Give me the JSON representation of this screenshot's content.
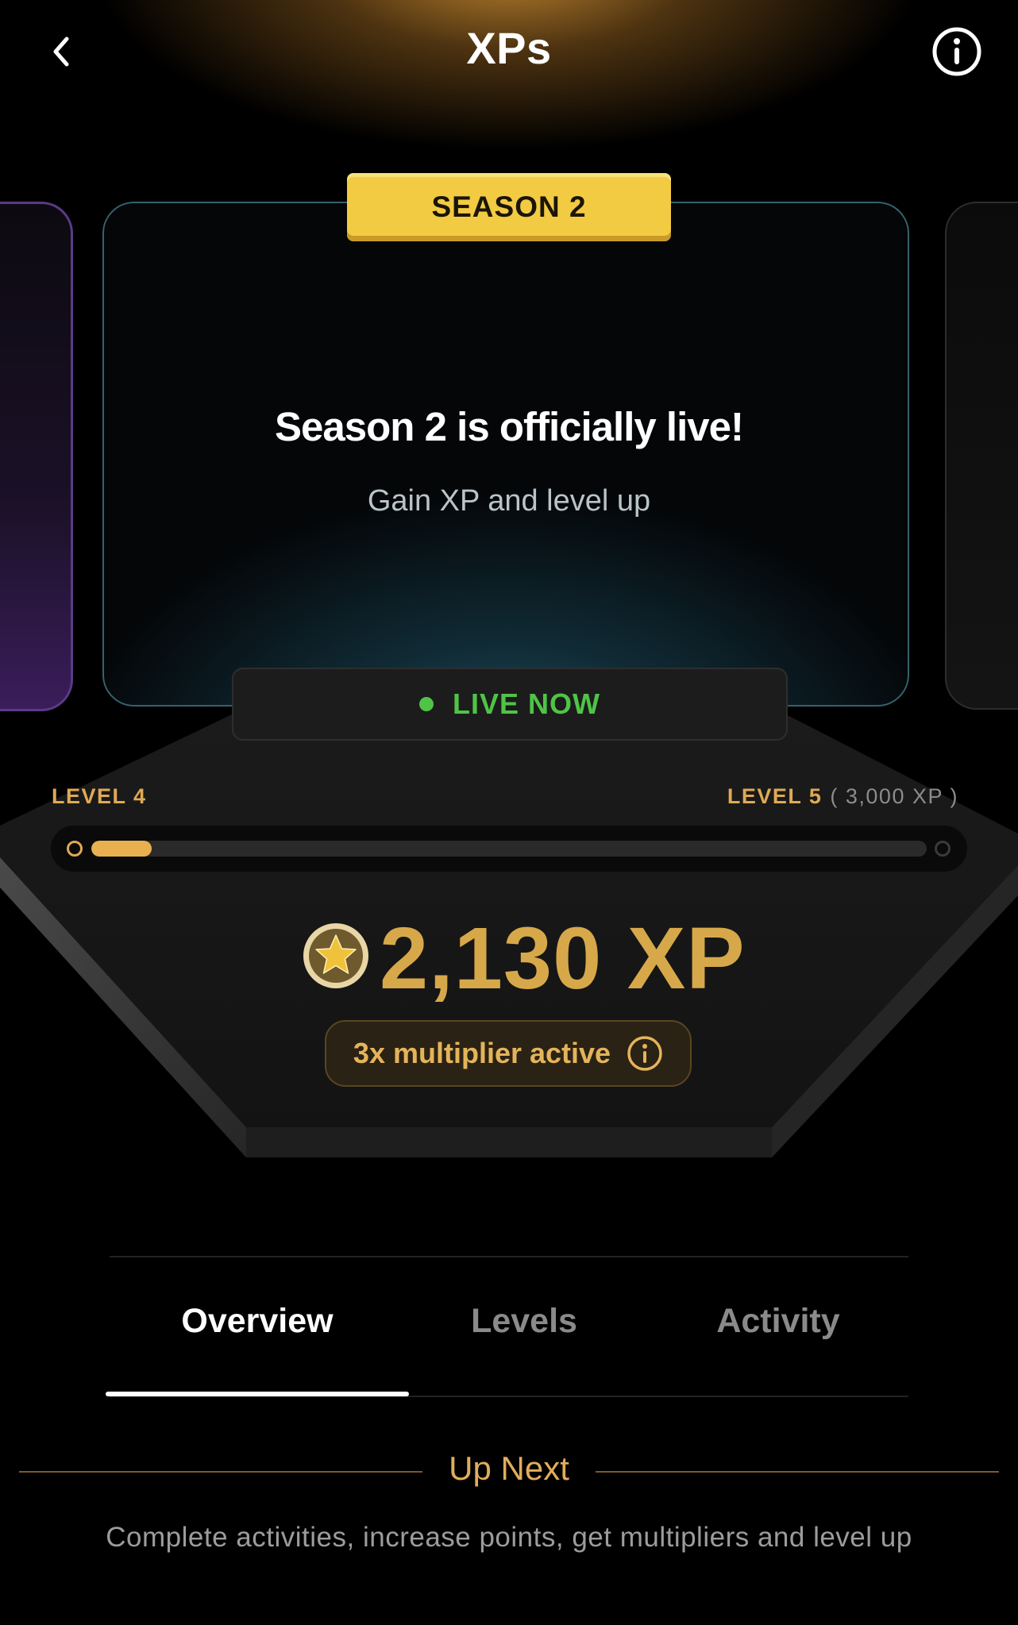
{
  "header": {
    "title": "XPs",
    "back_icon": "chevron-left-icon",
    "info_icon": "info-icon"
  },
  "carousel": {
    "badge": "SEASON 2",
    "headline": "Season 2 is officially live!",
    "subtitle": "Gain XP and level up",
    "status": "LIVE NOW"
  },
  "progress": {
    "current_level": "LEVEL 4",
    "next_level": "LEVEL 5",
    "next_level_xp": "( 3,000 XP )",
    "fill_fraction": 0.072
  },
  "xp": {
    "amount": "2,130 XP",
    "coin_icon": "star-coin-icon",
    "multiplier": "3x multiplier active"
  },
  "tabs": [
    {
      "label": "Overview",
      "active": true
    },
    {
      "label": "Levels",
      "active": false
    },
    {
      "label": "Activity",
      "active": false
    }
  ],
  "up_next": {
    "title": "Up Next",
    "description": "Complete activities, increase points, get multipliers and level up"
  },
  "colors": {
    "accent_gold": "#e0a954",
    "live_green": "#4fc446",
    "badge_yellow": "#f2cb43"
  }
}
